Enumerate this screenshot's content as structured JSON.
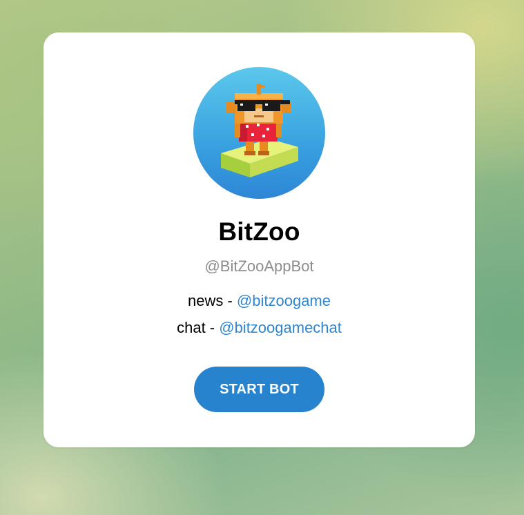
{
  "bot": {
    "name": "BitZoo",
    "username": "@BitZooAppBot",
    "description": [
      {
        "prefix": "news - ",
        "link": "@bitzoogame"
      },
      {
        "prefix": "chat - ",
        "link": "@bitzoogamechat"
      }
    ],
    "avatar_icon": "pixel-monkey-sunglasses-icon"
  },
  "actions": {
    "start_label": "START BOT"
  },
  "colors": {
    "accent": "#2783cd",
    "link": "#2f86d0",
    "username": "#8d8d8d",
    "card": "#ffffff"
  }
}
